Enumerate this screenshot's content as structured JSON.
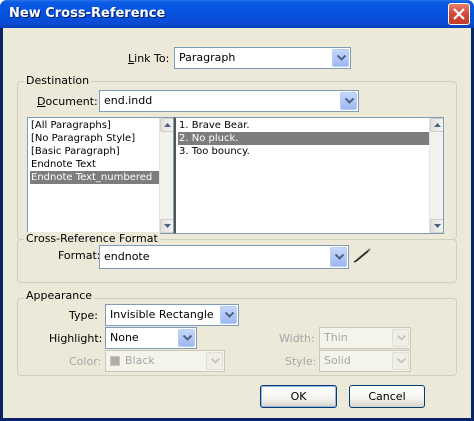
{
  "window": {
    "title": "New Cross-Reference"
  },
  "link_to": {
    "label_before": "Link To: ",
    "label_underline": "L",
    "label_rest": "ink To:",
    "value": "Paragraph"
  },
  "destination": {
    "group_title": "Destination",
    "document_label_u": "D",
    "document_label_rest": "ocument:",
    "document_value": "end.indd",
    "styles": [
      "[All Paragraphs]",
      "[No Paragraph Style]",
      "[Basic Paragraph]",
      "Endnote Text",
      "Endnote Text_numbered"
    ],
    "selected_style": "Endnote Text_numbered",
    "paragraphs": [
      "1. Brave Bear.",
      "2. No pluck.",
      "3. Too bouncy."
    ],
    "selected_paragraph": "2. No pluck."
  },
  "format_section": {
    "group_title": "Cross-Reference Format",
    "format_label": "Format:",
    "format_value": "endnote",
    "edit_icon": "pencil-icon"
  },
  "appearance": {
    "group_title": "Appearance",
    "type_label": "Type:",
    "type_value": "Invisible Rectangle",
    "highlight_label": "Highlight:",
    "highlight_value": "None",
    "width_label": "Width:",
    "width_value": "Thin",
    "color_label": "Color:",
    "color_value": "Black",
    "style_label": "Style:",
    "style_value": "Solid"
  },
  "buttons": {
    "ok": "OK",
    "cancel": "Cancel"
  }
}
